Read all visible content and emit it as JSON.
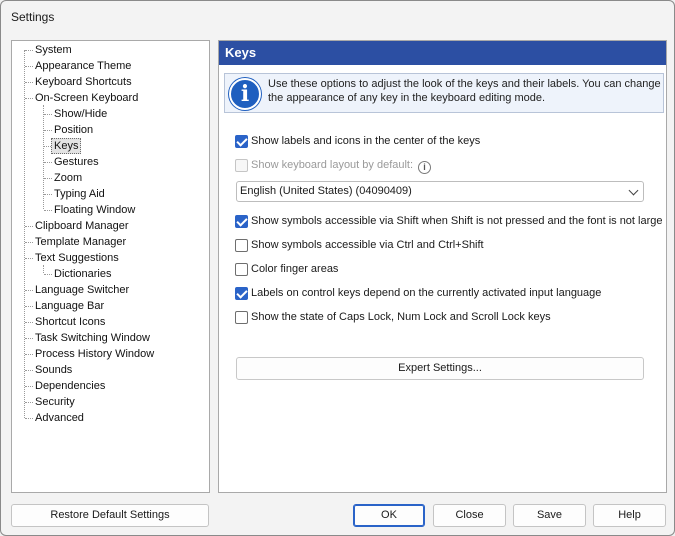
{
  "window": {
    "title": "Settings"
  },
  "tree": {
    "items": [
      {
        "label": "System"
      },
      {
        "label": "Appearance Theme"
      },
      {
        "label": "Keyboard Shortcuts"
      },
      {
        "label": "On-Screen Keyboard"
      },
      {
        "label": "Show/Hide"
      },
      {
        "label": "Position"
      },
      {
        "label": "Keys",
        "selected": true
      },
      {
        "label": "Gestures"
      },
      {
        "label": "Zoom"
      },
      {
        "label": "Typing Aid"
      },
      {
        "label": "Floating Window"
      },
      {
        "label": "Clipboard Manager"
      },
      {
        "label": "Template Manager"
      },
      {
        "label": "Text Suggestions"
      },
      {
        "label": "Dictionaries"
      },
      {
        "label": "Language Switcher"
      },
      {
        "label": "Language Bar"
      },
      {
        "label": "Shortcut Icons"
      },
      {
        "label": "Task Switching Window"
      },
      {
        "label": "Process History Window"
      },
      {
        "label": "Sounds"
      },
      {
        "label": "Dependencies"
      },
      {
        "label": "Security"
      },
      {
        "label": "Advanced"
      }
    ]
  },
  "panel": {
    "title": "Keys",
    "info": "Use these options to adjust the look of the keys and their labels. You can change the appearance of any key in the keyboard editing mode.",
    "options": {
      "show_labels": {
        "label": "Show labels and icons in the center of the keys",
        "checked": true
      },
      "show_layout": {
        "label": "Show keyboard layout by default:",
        "checked": false,
        "disabled": true
      },
      "shift_symbols": {
        "label": "Show symbols accessible via Shift when Shift is not pressed and the font is not large",
        "checked": true
      },
      "ctrl_symbols": {
        "label": "Show symbols accessible via Ctrl and Ctrl+Shift",
        "checked": false
      },
      "color_finger": {
        "label": "Color finger areas",
        "checked": false
      },
      "control_keys": {
        "label": "Labels on control keys depend on the currently activated input language",
        "checked": true
      },
      "caps_state": {
        "label": "Show the state of Caps Lock, Num Lock and Scroll Lock keys",
        "checked": false
      }
    },
    "layout_select": {
      "value": "English (United States) (04090409)"
    },
    "expert_button": "Expert Settings..."
  },
  "footer": {
    "restore": "Restore Default Settings",
    "ok": "OK",
    "close": "Close",
    "save": "Save",
    "help": "Help"
  },
  "colors": {
    "header_blue": "#2c4fa3",
    "check_blue": "#2a63c8"
  }
}
